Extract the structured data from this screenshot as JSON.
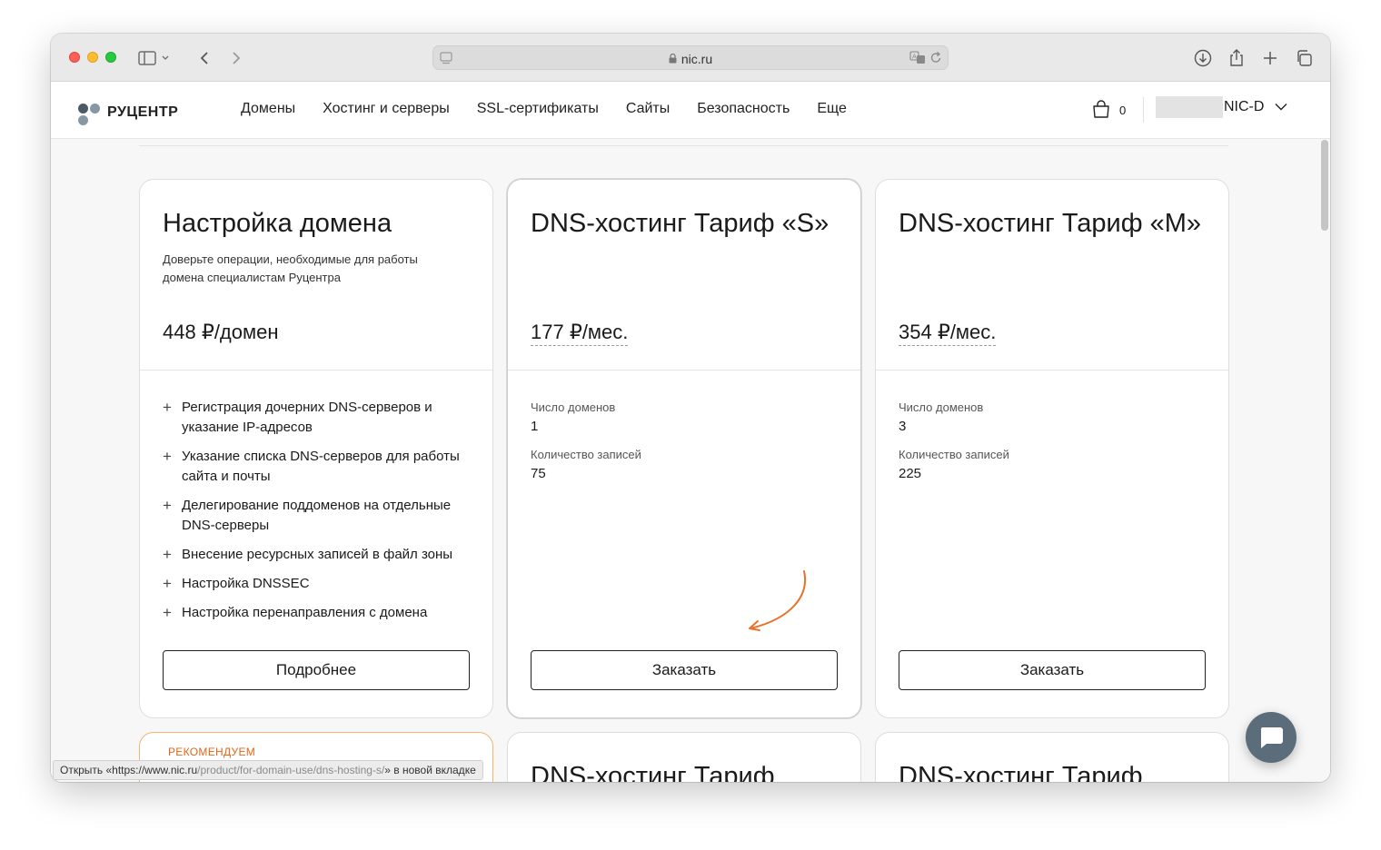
{
  "browser": {
    "url": "nic.ru",
    "status_text_prefix": "Открыть «",
    "status_text_url_dark": "https://www.nic.ru",
    "status_text_url_gray": "/product/for-domain-use/dns-hosting-s/",
    "status_text_suffix": "» в новой вкладке"
  },
  "header": {
    "logo_text": "РУЦЕНТР",
    "nav": [
      "Домены",
      "Хостинг и серверы",
      "SSL-сертификаты",
      "Сайты",
      "Безопасность",
      "Еще"
    ],
    "cart_count": "0",
    "account_code": "NIC-D"
  },
  "cards": [
    {
      "title": "Настройка домена",
      "description": "Доверьте операции, необходимые для работы домена специалистам Руцентра",
      "price": "448 ₽/домен",
      "features": [
        "Регистрация дочерних DNS-серверов и указание IP-адресов",
        "Указание списка DNS-серверов для работы сайта и почты",
        "Делегирование поддоменов на отдельные DNS-серверы",
        "Внесение ресурсных записей в файл зоны",
        "Настройка DNSSEC",
        "Настройка перенаправления с домена"
      ],
      "button": "Подробнее"
    },
    {
      "title": "DNS-хостинг Тариф «S»",
      "price": "177 ₽/мес.",
      "domains_label": "Число доменов",
      "domains_value": "1",
      "records_label": "Количество записей",
      "records_value": "75",
      "button": "Заказать"
    },
    {
      "title": "DNS-хостинг Тариф «M»",
      "price": "354 ₽/мес.",
      "domains_label": "Число доменов",
      "domains_value": "3",
      "records_label": "Количество записей",
      "records_value": "225",
      "button": "Заказать"
    }
  ],
  "next_row": {
    "badge": "РЕКОМЕНДУЕМ",
    "title_2": "DNS-хостинг Тариф",
    "title_3": "DNS-хостинг Тариф"
  },
  "colors": {
    "accent_orange": "#e0661a",
    "chat_button": "#5b6c7a",
    "logo_dot_dark": "#4b5a66",
    "logo_dot_light": "#8797a3"
  }
}
